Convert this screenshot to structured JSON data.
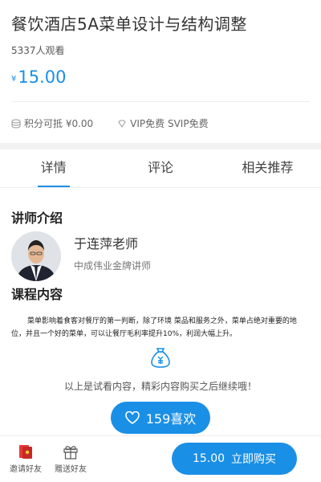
{
  "course": {
    "title": "餐饮酒店5A菜单设计与结构调整",
    "views": "5337人观看",
    "currency": "¥",
    "price": "15.00"
  },
  "perks": {
    "points": "积分可抵 ¥0.00",
    "vip": "VIP免费 SVIP免费"
  },
  "tabs": [
    {
      "label": "详情",
      "active": true
    },
    {
      "label": "评论",
      "active": false
    },
    {
      "label": "相关推荐",
      "active": false
    }
  ],
  "teacher": {
    "section_title": "讲师介绍",
    "name": "于连萍老师",
    "title": "中成伟业金牌讲师"
  },
  "content": {
    "section_title": "课程内容",
    "intro": "菜单影响着食客对餐厅的第一判断，除了环境 菜品和服务之外，菜单占绝对重要的地位，并且一个好的菜单，可以让餐厅毛利率提升10%，利润大幅上升。",
    "trial_note": "以上是试看内容，精彩内容购买之后继续哦！",
    "likes": "159喜欢"
  },
  "bottom_bar": {
    "invite_label": "邀请好友",
    "gift_label": "赠送好友",
    "buy_price": "15.00",
    "buy_label": "立即购买"
  },
  "colors": {
    "accent": "#1a8fe6"
  }
}
